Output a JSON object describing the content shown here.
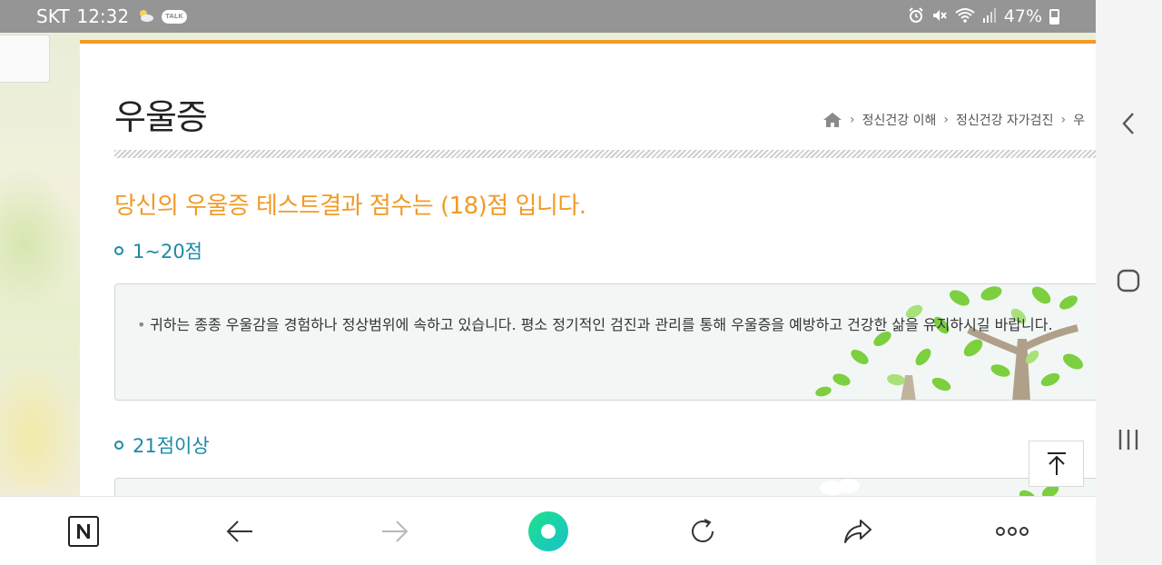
{
  "status_bar": {
    "carrier": "SKT",
    "time": "12:32",
    "talk_badge": "TALK",
    "battery": "47%"
  },
  "page": {
    "title": "우울증",
    "breadcrumb": [
      "정신건강 이해",
      "정신건강 자가검진",
      "우"
    ],
    "result_text": "당신의 우울증 테스트결과 점수는 (18)점 입니다.",
    "sections": [
      {
        "heading": "1~20점",
        "text": "귀하는 종종 우울감을 경험하나 정상범위에 속하고 있습니다. 평소 정기적인 검진과 관리를 통해 우울증을 예방하고 건강한 삶을 유지하시길 바랍니다."
      },
      {
        "heading": "21점이상",
        "text": ""
      }
    ]
  },
  "toolbar": {
    "icons": [
      "naver-home-icon",
      "back-arrow-icon",
      "forward-arrow-icon",
      "green-dot-icon",
      "refresh-icon",
      "share-icon",
      "more-icon"
    ]
  },
  "navbar": {
    "icons": [
      "nav-back-icon",
      "nav-home-icon",
      "nav-recents-icon"
    ]
  },
  "colors": {
    "accent_orange": "#f19a26",
    "teal": "#1d8aa5",
    "status_bar": "#959595",
    "green_button": "#1fd39a"
  }
}
